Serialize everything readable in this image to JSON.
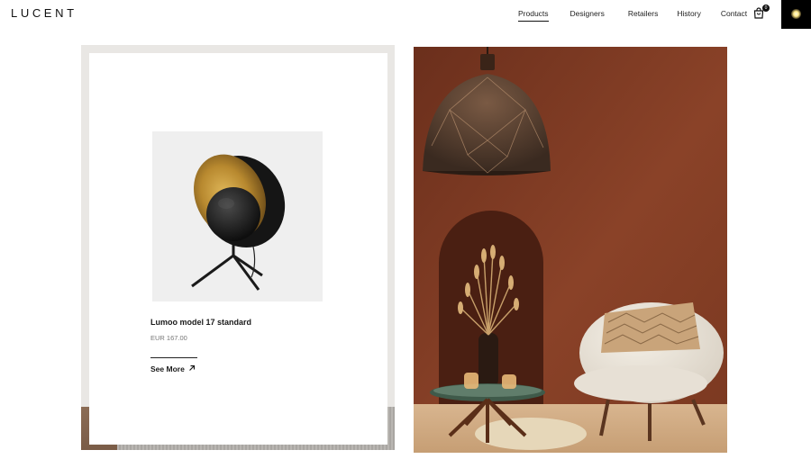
{
  "brand": {
    "logo": "LUCENT"
  },
  "nav": {
    "items": [
      {
        "label": "Products",
        "active": true
      },
      {
        "label": "Designers",
        "active": false
      },
      {
        "label": "Retailers",
        "active": false
      },
      {
        "label": "History",
        "active": false
      },
      {
        "label": "Contact",
        "active": false
      }
    ]
  },
  "cart": {
    "icon": "shopping-bag-icon",
    "count": "0"
  },
  "lamp_toggle": {
    "icon": "lamp-glow-icon"
  },
  "product": {
    "name": "Lumoo model 17 standard",
    "price": "EUR 167.00",
    "see_more_label": "See More",
    "see_more_icon": "arrow-up-right-icon"
  },
  "colors": {
    "accent": "#111111",
    "wall": "#7a3a22",
    "lamp_gold": "#b8892f"
  }
}
